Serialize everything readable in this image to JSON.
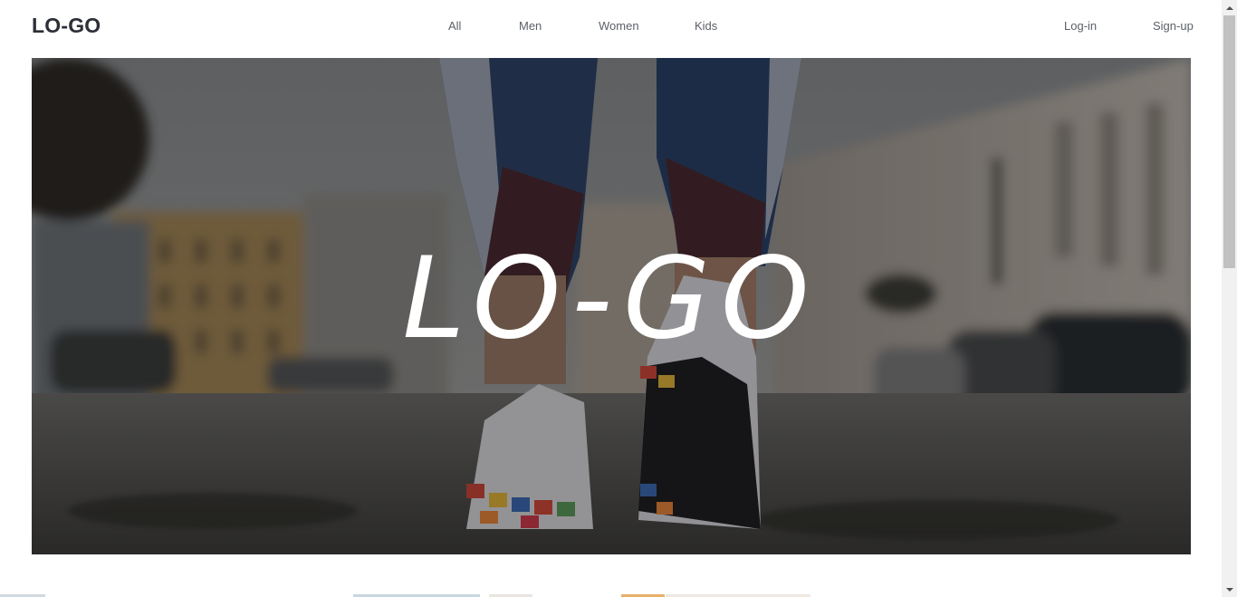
{
  "header": {
    "brand": "LO-GO",
    "nav": {
      "all": "All",
      "men": "Men",
      "women": "Women",
      "kids": "Kids"
    },
    "auth": {
      "login": "Log-in",
      "signup": "Sign-up"
    }
  },
  "hero": {
    "title": "LO-GO",
    "image": "runner-shoes-street-photo"
  },
  "colors": {
    "brand_text": "#2c2f36",
    "nav_text": "#5b6068",
    "hero_overlay": "#000000",
    "page_bg": "#ffffff"
  }
}
